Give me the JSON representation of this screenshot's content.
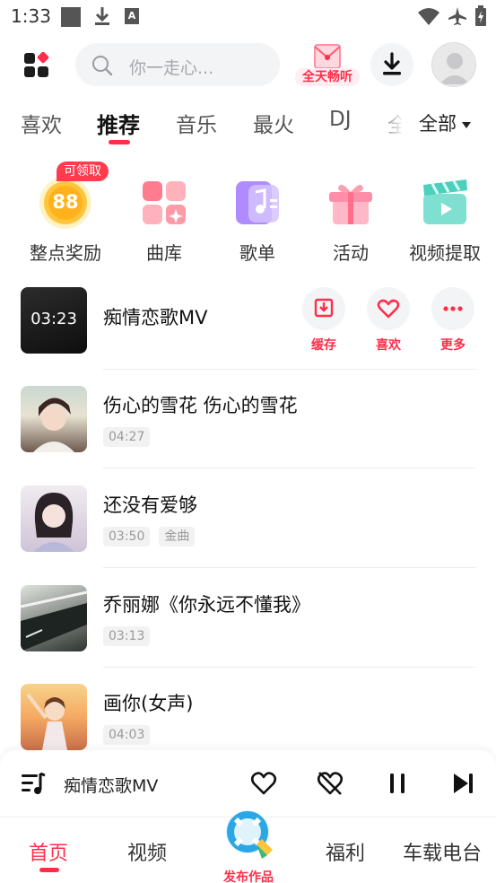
{
  "status_bar": {
    "time": "1:33",
    "a_label": "A"
  },
  "header": {
    "search_placeholder": "你一走心...",
    "vip_label": "全天畅听"
  },
  "tabs": [
    {
      "label": "喜欢"
    },
    {
      "label": "推荐"
    },
    {
      "label": "音乐"
    },
    {
      "label": "最火"
    },
    {
      "label": "DJ"
    },
    {
      "label": "全"
    }
  ],
  "tabs_all": "全部",
  "categories": [
    {
      "label": "整点奖励",
      "badge": "可领取",
      "value": "88"
    },
    {
      "label": "曲库"
    },
    {
      "label": "歌单"
    },
    {
      "label": "活动"
    },
    {
      "label": "视频提取"
    }
  ],
  "songs": [
    {
      "title": "痴情恋歌MV",
      "duration": "03:23"
    },
    {
      "title": "伤心的雪花 伤心的雪花",
      "duration": "04:27"
    },
    {
      "title": "还没有爱够",
      "duration": "03:50",
      "tag": "金曲"
    },
    {
      "title": "乔丽娜《你永远不懂我》",
      "duration": "03:13"
    },
    {
      "title": "画你(女声)",
      "duration": "04:03"
    }
  ],
  "song_actions": {
    "cache": "缓存",
    "like": "喜欢",
    "more": "更多"
  },
  "player": {
    "title": "痴情恋歌MV"
  },
  "bottom_nav": {
    "home": "首页",
    "video": "视频",
    "publish": "发布作品",
    "welfare": "福利",
    "radio": "车载电台"
  },
  "colors": {
    "accent": "#ff2d4a",
    "chip_bg": "#f2f2f3"
  }
}
